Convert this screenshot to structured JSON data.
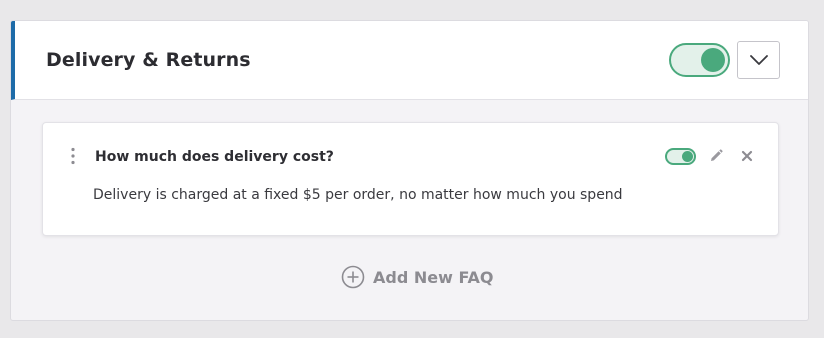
{
  "section": {
    "title": "Delivery & Returns",
    "enabled": true,
    "accent_color": "#1e6ba8",
    "toggle_color": "#4aa97d"
  },
  "faqs": [
    {
      "question": "How much does delivery cost?",
      "answer": "Delivery is charged at a fixed $5 per order, no matter how much you spend",
      "enabled": true
    }
  ],
  "add_faq": {
    "label": "Add New FAQ",
    "icon": "plus-circle-icon"
  },
  "icons": {
    "collapse": "chevron-down-icon",
    "drag": "drag-handle-icon",
    "edit": "pencil-icon",
    "delete": "close-icon"
  }
}
